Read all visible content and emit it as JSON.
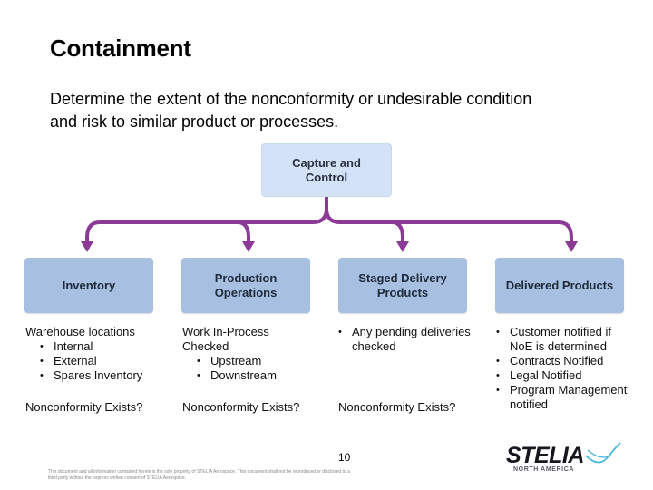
{
  "slide": {
    "title": "Containment",
    "intro_lines": [
      "Determine the extent of the nonconformity or undesirable condition",
      "and risk to similar product or processes."
    ],
    "page_number": "10"
  },
  "diagram": {
    "root": {
      "lines": [
        "Capture and",
        "Control"
      ]
    },
    "connector_color": "#8b3a95",
    "box_color": "#a7c0e2",
    "root_box_color": "#d3e2f6",
    "children": [
      {
        "lines": [
          "Inventory"
        ],
        "heading_lines": [
          "Warehouse locations"
        ],
        "bullets": [
          "Internal",
          "External",
          "Spares Inventory"
        ],
        "question": "Nonconformity Exists?"
      },
      {
        "lines": [
          "Production",
          "Operations"
        ],
        "heading_lines": [
          "Work In-Process",
          "Checked"
        ],
        "bullets": [
          "Upstream",
          "Downstream"
        ],
        "question": "Nonconformity Exists?"
      },
      {
        "lines": [
          "Staged Delivery",
          "Products"
        ],
        "bullets": [
          "Any pending deliveries|checked"
        ],
        "question": "Nonconformity Exists?"
      },
      {
        "lines": [
          "Delivered Products"
        ],
        "bullets": [
          "Customer notified if|NoE is determined",
          "Contracts Notified",
          "Legal Notified",
          "Program Management|notified"
        ]
      }
    ]
  },
  "footer": {
    "disclaimer": "This document and all information contained herein is the sole property of STELIA Aerospace. This document shall not be reproduced or disclosed to a third party without the express written consent of STELIA Aerospace.",
    "logo": {
      "name": "STELIA",
      "subtitle": "NORTH AMERICA",
      "accent": "#3fb4e0"
    }
  }
}
